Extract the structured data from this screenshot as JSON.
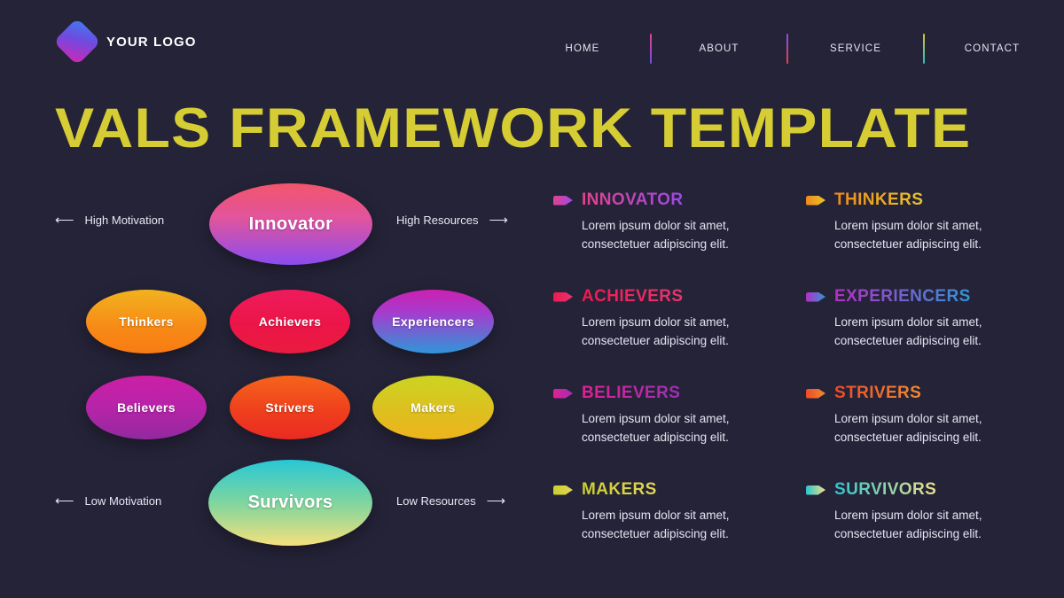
{
  "header": {
    "logo_text": "YOUR LOGO",
    "nav": [
      {
        "label": "HOME"
      },
      {
        "label": "ABOUT"
      },
      {
        "label": "SERVICE"
      },
      {
        "label": "CONTACT"
      }
    ]
  },
  "page_title": "VALS FRAMEWORK TEMPLATE",
  "diagram": {
    "axis_labels": {
      "high_motivation": "High Motivation",
      "high_resources": "High Resources",
      "low_motivation": "Low Motivation",
      "low_resources": "Low Resources",
      "arrow_left": "⟵",
      "arrow_right": "⟶"
    },
    "nodes": [
      {
        "label": "Innovator",
        "color_from": "#f2556b",
        "color_to": "#8b4cf0"
      },
      {
        "label": "Thinkers",
        "color_from": "#f2b21f",
        "color_to": "#f97b12"
      },
      {
        "label": "Achievers",
        "color_from": "#ef1a5c",
        "color_to": "#ea1b3f"
      },
      {
        "label": "Experiencers",
        "color_from": "#cc20b0",
        "color_to": "#2f96d8"
      },
      {
        "label": "Believers",
        "color_from": "#cc1fa6",
        "color_to": "#93299e"
      },
      {
        "label": "Strivers",
        "color_from": "#f5641b",
        "color_to": "#ea2a22"
      },
      {
        "label": "Makers",
        "color_from": "#ccd422",
        "color_to": "#eeb41c"
      },
      {
        "label": "Survivors",
        "color_from": "#28c8d6",
        "color_to": "#f6e07c"
      }
    ]
  },
  "legend": [
    {
      "title": "INNOVATOR",
      "body": "Lorem ipsum dolor sit amet, consectetuer adipiscing elit.",
      "color_from": "#e5418d",
      "color_to": "#9a4ae6"
    },
    {
      "title": "THINKERS",
      "body": "Lorem ipsum dolor sit amet, consectetuer adipiscing elit.",
      "color_from": "#ef8a1b",
      "color_to": "#e8c42a"
    },
    {
      "title": "ACHIEVERS",
      "body": "Lorem ipsum dolor sit amet, consectetuer adipiscing elit.",
      "color_from": "#ed1a4f",
      "color_to": "#e8356e"
    },
    {
      "title": "EXPERIENCERS",
      "body": "Lorem ipsum dolor sit amet, consectetuer adipiscing elit.",
      "color_from": "#b52fc4",
      "color_to": "#2f96d8"
    },
    {
      "title": "BELIEVERS",
      "body": "Lorem ipsum dolor sit amet, consectetuer adipiscing elit.",
      "color_from": "#e31f92",
      "color_to": "#a02fb6"
    },
    {
      "title": "STRIVERS",
      "body": "Lorem ipsum dolor sit amet, consectetuer adipiscing elit.",
      "color_from": "#ee4b24",
      "color_to": "#ef8a34"
    },
    {
      "title": "MAKERS",
      "body": "Lorem ipsum dolor sit amet, consectetuer adipiscing elit.",
      "color_from": "#c9cf2c",
      "color_to": "#e3d657"
    },
    {
      "title": "SURVIVORS",
      "body": "Lorem ipsum dolor sit amet, consectetuer adipiscing elit.",
      "color_from": "#2bc6cf",
      "color_to": "#f0e08a"
    }
  ],
  "theme": {
    "background": "#252338",
    "title_color": "#d6cc33",
    "text_color": "#e6e4f0"
  }
}
